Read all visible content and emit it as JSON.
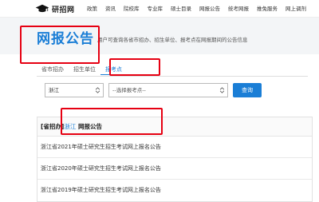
{
  "site": {
    "logo_text": "研招网"
  },
  "nav": [
    "政策",
    "资讯",
    "院校库",
    "专业库",
    "硕士目录",
    "网报公告",
    "统考网报",
    "推免服务",
    "网上调剂"
  ],
  "banner": {
    "title": "网报公告",
    "description": "用户可查询各省市招办、招生单位、报考点在网报期间的公告信息"
  },
  "tabs": [
    "省市招办",
    "招生单位",
    "报考点"
  ],
  "active_tab": "报考点",
  "filters": {
    "province_value": "浙江",
    "unit_placeholder": "--选择报考点--",
    "search_label": "查询"
  },
  "section": {
    "prefix": "[省招办]",
    "province": "浙江",
    "title": "网报公告"
  },
  "announcements": [
    "浙江省2021年硕士研究生招生考试网上报名公告",
    "浙江省2020年硕士研究生招生考试网上报名公告",
    "浙江省2019年硕士研究生招生考试网上报名公告"
  ],
  "colors": {
    "accent": "#1a7ed6",
    "highlight": "#e60012"
  }
}
